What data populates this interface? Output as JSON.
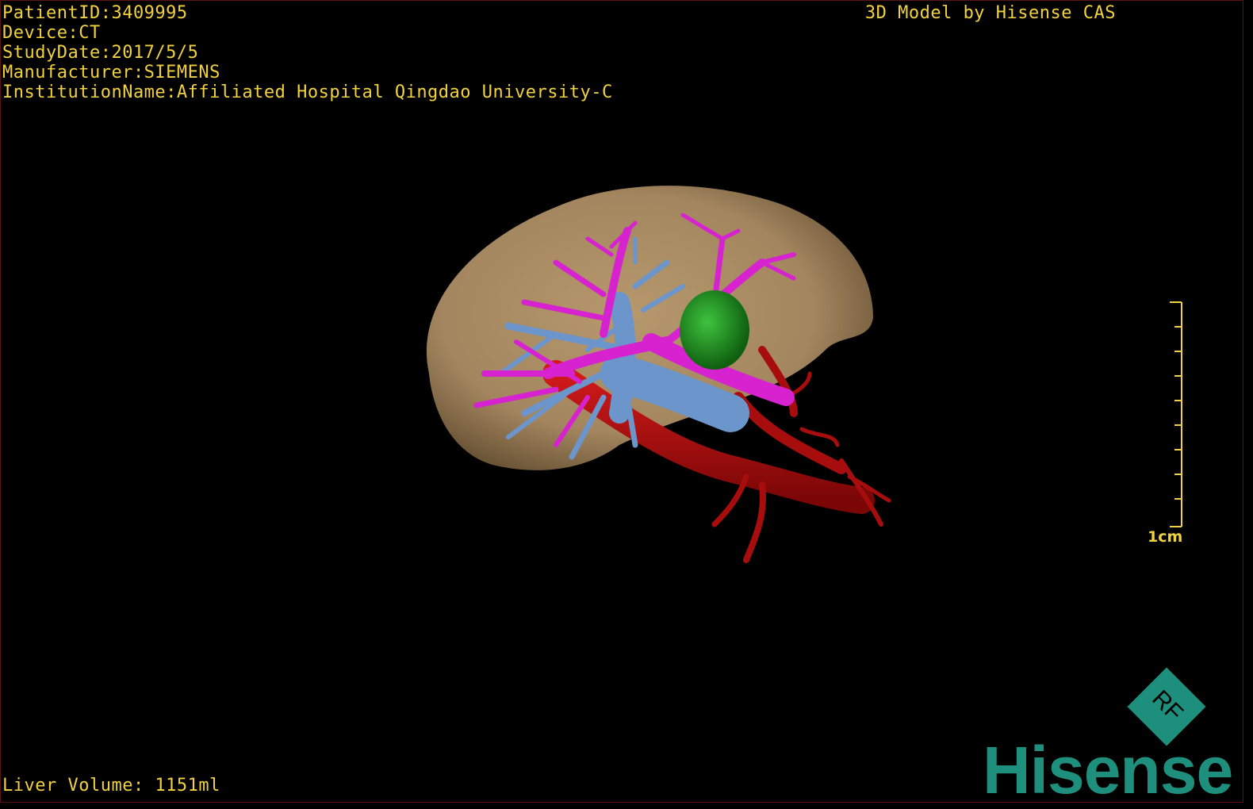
{
  "overlay": {
    "patient_id": "PatientID:3409995",
    "device": "Device:CT",
    "study_date": "StudyDate:2017/5/5",
    "manufacturer": "Manufacturer:SIEMENS",
    "institution": "InstitutionName:Affiliated Hospital Qingdao University-C",
    "model_title": "3D Model by Hisense CAS",
    "liver_volume": "Liver Volume: 1151ml",
    "scale_label": "1cm"
  },
  "branding": {
    "logo_text": "Hisense",
    "badge_text": "RF",
    "brand_color": "#1f8f7d"
  },
  "colors": {
    "text": "#f1d23e",
    "liver": "#a98b64",
    "hepatic_vein": "#d623cf",
    "portal_vein": "#6c95cc",
    "arteries": "#b30d0d",
    "tumor": "#1b8a1b"
  }
}
